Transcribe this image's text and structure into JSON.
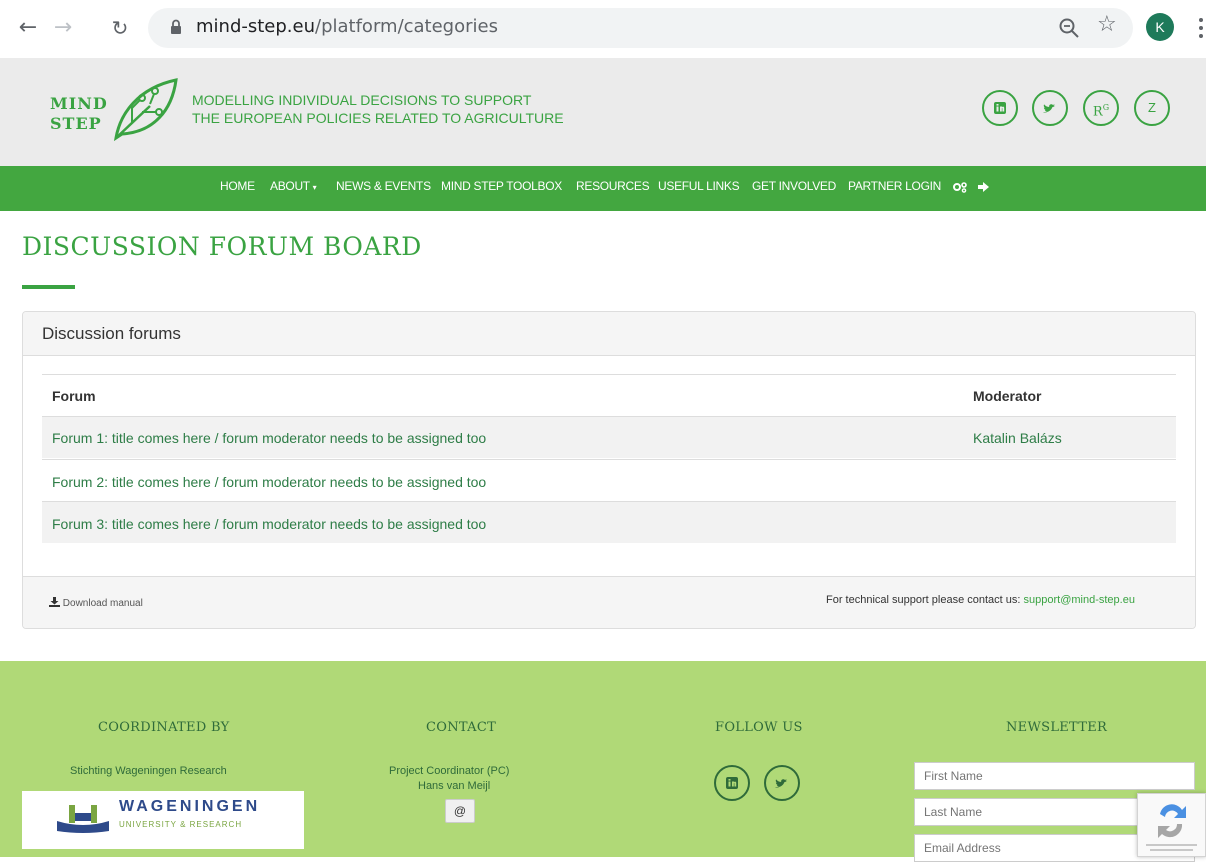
{
  "browser": {
    "url_host": "mind-step.eu",
    "url_path": "/platform/categories",
    "profile_initial": "K"
  },
  "header": {
    "logo_line1": "MIND",
    "logo_line2": "STEP",
    "tagline_line1": "MODELLING INDIVIDUAL DECISIONS TO SUPPORT",
    "tagline_line2": "THE EUROPEAN POLICIES RELATED TO AGRICULTURE",
    "social": [
      "linkedin-icon",
      "twitter-icon",
      "researchgate-icon",
      "zenodo-icon"
    ],
    "researchgate_label": "R",
    "researchgate_sup": "G",
    "zenodo_label": "Z"
  },
  "nav": {
    "items": [
      "HOME",
      "ABOUT",
      "NEWS & EVENTS",
      "MIND STEP TOOLBOX",
      "RESOURCES",
      "USEFUL LINKS",
      "GET INVOLVED",
      "PARTNER LOGIN"
    ],
    "about_caret": "▾"
  },
  "main": {
    "title": "DISCUSSION FORUM BOARD",
    "panel_title": "Discussion forums",
    "columns": [
      "Forum",
      "Moderator"
    ],
    "rows": [
      {
        "forum": "Forum 1: title comes here / forum moderator needs to be assigned too",
        "moderator": "Katalin Balázs"
      },
      {
        "forum": "Forum 2: title comes here / forum moderator needs to be assigned too",
        "moderator": ""
      },
      {
        "forum": "Forum 3: title comes here / forum moderator needs to be assigned too",
        "moderator": ""
      }
    ],
    "download_label": "Download manual",
    "support_text": "For technical support please contact us: ",
    "support_email": "support@mind-step.eu"
  },
  "footer": {
    "coordinated_by_heading": "COORDINATED BY",
    "coordinator": "Stichting Wageningen Research",
    "wur_name": "WAGENINGEN",
    "wur_sub": "UNIVERSITY & RESEARCH",
    "contact_heading": "CONTACT",
    "contact_role": "Project Coordinator (PC)",
    "contact_name": "Hans van Meijl",
    "email_symbol": "@",
    "follow_heading": "FOLLOW US",
    "newsletter_heading": "NEWSLETTER",
    "first_name_placeholder": "First Name",
    "last_name_placeholder": "Last Name",
    "email_placeholder": "Email Address"
  },
  "colors": {
    "brand_green": "#43a740",
    "link_green": "#2e7d47",
    "footer_green": "#b0d977"
  }
}
